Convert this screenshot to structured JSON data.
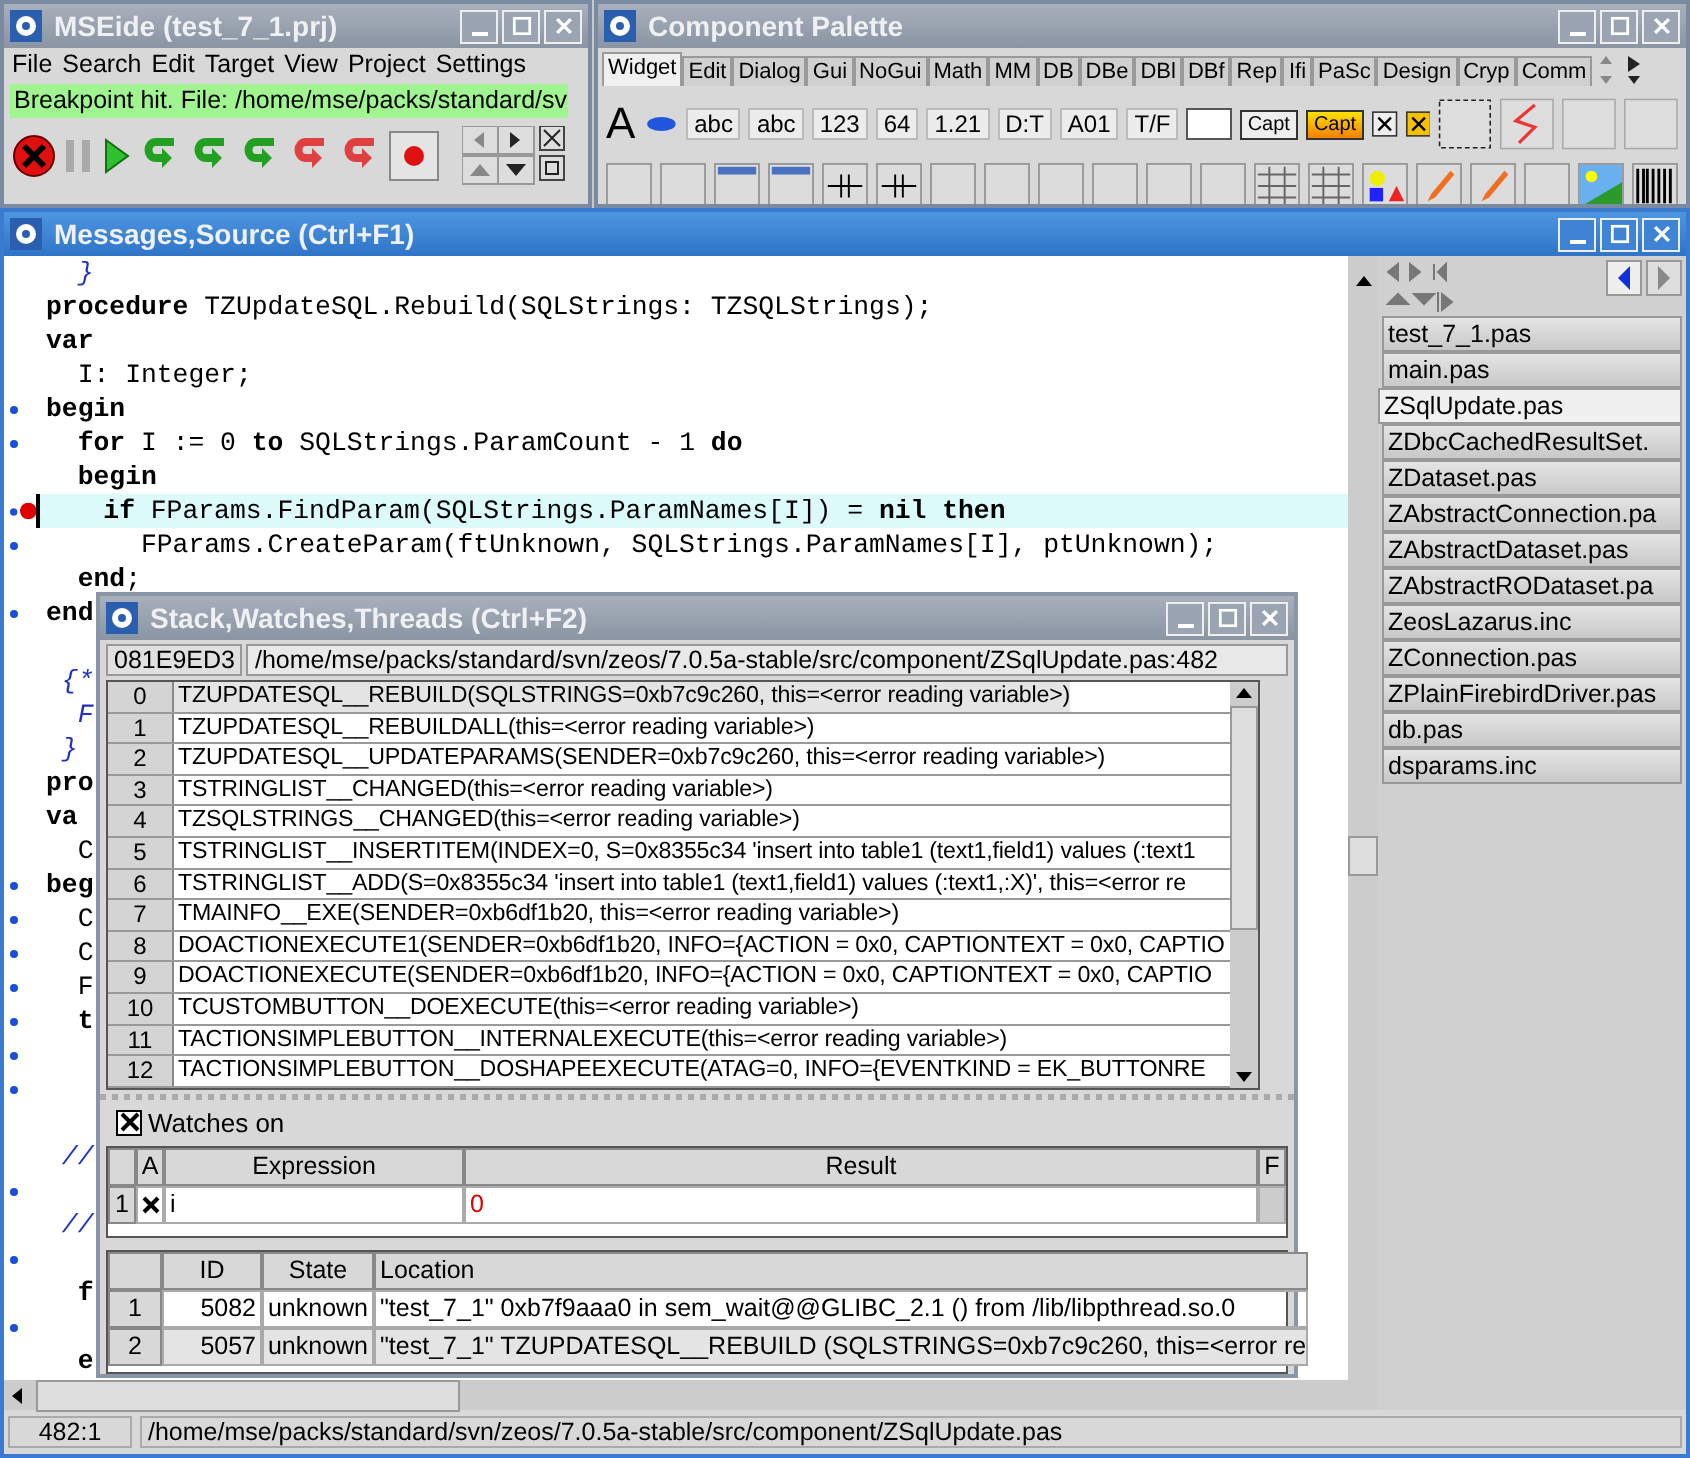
{
  "main_window": {
    "title": "MSEide (test_7_1.prj)",
    "active": false,
    "menu": [
      "File",
      "Search",
      "Edit",
      "Target",
      "View",
      "Project",
      "Settings"
    ],
    "status": "Breakpoint hit. File: /home/mse/packs/standard/sv"
  },
  "palette_window": {
    "title": "Component Palette",
    "active": false,
    "tabs": [
      {
        "label": "Widget",
        "selected": true
      },
      {
        "label": "Edit",
        "selected": false
      },
      {
        "label": "Dialog",
        "selected": false
      },
      {
        "label": "Gui",
        "selected": false
      },
      {
        "label": "NoGui",
        "selected": false
      },
      {
        "label": "Math",
        "selected": false
      },
      {
        "label": "MM",
        "selected": false
      },
      {
        "label": "DB",
        "selected": false
      },
      {
        "label": "DBe",
        "selected": false
      },
      {
        "label": "DBl",
        "selected": false
      },
      {
        "label": "DBf",
        "selected": false
      },
      {
        "label": "Rep",
        "selected": false
      },
      {
        "label": "Ifi",
        "selected": false
      },
      {
        "label": "PaSc",
        "selected": false
      },
      {
        "label": "Design",
        "selected": false
      },
      {
        "label": "Cryp",
        "selected": false
      },
      {
        "label": "Comm",
        "selected": false
      }
    ],
    "components": [
      {
        "label": "A",
        "kind": "large"
      },
      {
        "label": "abc",
        "kind": "field"
      },
      {
        "label": "abc",
        "kind": "field"
      },
      {
        "label": "123",
        "kind": "field"
      },
      {
        "label": "64",
        "kind": "field"
      },
      {
        "label": "1.21",
        "kind": "field"
      },
      {
        "label": "D:T",
        "kind": "field"
      },
      {
        "label": "A01",
        "kind": "field"
      },
      {
        "label": "T/F",
        "kind": "field"
      },
      {
        "label": "Capt",
        "kind": "button"
      },
      {
        "label": "Capt",
        "kind": "accent"
      }
    ]
  },
  "source_window": {
    "title": "Messages,Source (Ctrl+F1)",
    "active": true,
    "code_lines": [
      {
        "text": "  }",
        "kind": "comment",
        "exec_mark": false,
        "breakpoint": false,
        "current": false
      },
      {
        "text": "**procedure** TZUpdateSQL.Rebuild(SQLStrings: TZSQLStrings);",
        "kind": "code",
        "exec_mark": false,
        "breakpoint": false,
        "current": false
      },
      {
        "text": "**var**",
        "kind": "code",
        "exec_mark": false,
        "breakpoint": false,
        "current": false
      },
      {
        "text": "  I: Integer;",
        "kind": "code",
        "exec_mark": false,
        "breakpoint": false,
        "current": false
      },
      {
        "text": "**begin**",
        "kind": "code",
        "exec_mark": true,
        "breakpoint": false,
        "current": false
      },
      {
        "text": "  **for** I := 0 **to** SQLStrings.ParamCount - 1 **do**",
        "kind": "code",
        "exec_mark": true,
        "breakpoint": false,
        "current": false
      },
      {
        "text": "  **begin**",
        "kind": "code",
        "exec_mark": false,
        "breakpoint": false,
        "current": false
      },
      {
        "text": "    **if** FParams.FindParam(SQLStrings.ParamNames[I]) = **nil** **then**",
        "kind": "code",
        "exec_mark": true,
        "breakpoint": true,
        "current": true
      },
      {
        "text": "      FParams.CreateParam(ftUnknown, SQLStrings.ParamNames[I], ptUnknown);",
        "kind": "code",
        "exec_mark": true,
        "breakpoint": false,
        "current": false
      },
      {
        "text": "  **end**;",
        "kind": "code",
        "exec_mark": false,
        "breakpoint": false,
        "current": false
      },
      {
        "text": "**end**",
        "kind": "code",
        "exec_mark": true,
        "breakpoint": false,
        "current": false
      },
      {
        "exec_mark": false,
        "breakpoint": false,
        "current": false
      },
      {
        "text": " {*",
        "kind": "comment",
        "exec_mark": false,
        "breakpoint": false,
        "current": false
      },
      {
        "text": "  F",
        "kind": "comment",
        "exec_mark": false,
        "breakpoint": false,
        "current": false
      },
      {
        "text": " }",
        "kind": "comment",
        "exec_mark": false,
        "breakpoint": false,
        "current": false
      },
      {
        "text": "**pro**",
        "kind": "code",
        "exec_mark": false,
        "breakpoint": false,
        "current": false
      },
      {
        "text": "**va**",
        "kind": "code",
        "exec_mark": false,
        "breakpoint": false,
        "current": false
      },
      {
        "text": "  C",
        "kind": "code",
        "exec_mark": false,
        "breakpoint": false,
        "current": false
      },
      {
        "text": "**beg**",
        "kind": "code",
        "exec_mark": true,
        "breakpoint": false,
        "current": false
      },
      {
        "text": "  C",
        "kind": "code",
        "exec_mark": true,
        "breakpoint": false,
        "current": false
      },
      {
        "text": "  C",
        "kind": "code",
        "exec_mark": true,
        "breakpoint": false,
        "current": false
      },
      {
        "text": "  F",
        "kind": "code",
        "exec_mark": true,
        "breakpoint": false,
        "current": false
      },
      {
        "text": "  **t**",
        "kind": "code",
        "exec_mark": true,
        "breakpoint": false,
        "current": false
      },
      {
        "exec_mark": true,
        "breakpoint": false,
        "current": false
      },
      {
        "exec_mark": true,
        "breakpoint": false,
        "current": false
      },
      {
        "exec_mark": false,
        "breakpoint": false,
        "current": false
      },
      {
        "text": " //",
        "kind": "comment",
        "exec_mark": false,
        "breakpoint": false,
        "current": false
      },
      {
        "exec_mark": true,
        "breakpoint": false,
        "current": false
      },
      {
        "text": " //",
        "kind": "comment",
        "exec_mark": false,
        "breakpoint": false,
        "current": false
      },
      {
        "exec_mark": true,
        "breakpoint": false,
        "current": false
      },
      {
        "text": "  **f**",
        "kind": "code",
        "exec_mark": false,
        "breakpoint": false,
        "current": false
      },
      {
        "exec_mark": true,
        "breakpoint": false,
        "current": false
      },
      {
        "text": "  **e**",
        "kind": "code",
        "exec_mark": false,
        "breakpoint": false,
        "current": false
      }
    ],
    "file_tabs": [
      {
        "label": "test_7_1.pas",
        "selected": false
      },
      {
        "label": "main.pas",
        "selected": false
      },
      {
        "label": "ZSqlUpdate.pas",
        "selected": true
      },
      {
        "label": "ZDbcCachedResultSet.",
        "selected": false
      },
      {
        "label": "ZDataset.pas",
        "selected": false
      },
      {
        "label": "ZAbstractConnection.pa",
        "selected": false
      },
      {
        "label": "ZAbstractDataset.pas",
        "selected": false
      },
      {
        "label": "ZAbstractRODataset.pa",
        "selected": false
      },
      {
        "label": "ZeosLazarus.inc",
        "selected": false
      },
      {
        "label": "ZConnection.pas",
        "selected": false
      },
      {
        "label": "ZPlainFirebirdDriver.pas",
        "selected": false
      },
      {
        "label": "db.pas",
        "selected": false
      },
      {
        "label": "dsparams.inc",
        "selected": false
      }
    ],
    "status_bar": {
      "position": "482:1",
      "path": "/home/mse/packs/standard/svn/zeos/7.0.5a-stable/src/component/ZSqlUpdate.pas"
    }
  },
  "debug_window": {
    "title": "Stack,Watches,Threads (Ctrl+F2)",
    "active": false,
    "address": "081E9ED3",
    "location": "/home/mse/packs/standard/svn/zeos/7.0.5a-stable/src/component/ZSqlUpdate.pas:482",
    "stack": [
      {
        "index": "0",
        "frame": "TZUPDATESQL__REBUILD(SQLSTRINGS=0xb7c9c260, this=<error reading variable>)",
        "selected": true
      },
      {
        "index": "1",
        "frame": "TZUPDATESQL__REBUILDALL(this=<error reading variable>)",
        "selected": false
      },
      {
        "index": "2",
        "frame": "TZUPDATESQL__UPDATEPARAMS(SENDER=0xb7c9c260, this=<error reading variable>)",
        "selected": false
      },
      {
        "index": "3",
        "frame": "TSTRINGLIST__CHANGED(this=<error reading variable>)",
        "selected": false
      },
      {
        "index": "4",
        "frame": "TZSQLSTRINGS__CHANGED(this=<error reading variable>)",
        "selected": false
      },
      {
        "index": "5",
        "frame": "TSTRINGLIST__INSERTITEM(INDEX=0, S=0x8355c34 'insert into table1 (text1,field1) values (:text1",
        "selected": false
      },
      {
        "index": "6",
        "frame": "TSTRINGLIST__ADD(S=0x8355c34 'insert into table1 (text1,field1) values (:text1,:X)', this=<error re",
        "selected": false
      },
      {
        "index": "7",
        "frame": "TMAINFO__EXE(SENDER=0xb6df1b20, this=<error reading variable>)",
        "selected": false
      },
      {
        "index": "8",
        "frame": "DOACTIONEXECUTE1(SENDER=0xb6df1b20, INFO={ACTION = 0x0, CAPTIONTEXT = 0x0, CAPTIO",
        "selected": false
      },
      {
        "index": "9",
        "frame": "DOACTIONEXECUTE(SENDER=0xb6df1b20, INFO={ACTION = 0x0, CAPTIONTEXT = 0x0, CAPTIO",
        "selected": false
      },
      {
        "index": "10",
        "frame": "TCUSTOMBUTTON__DOEXECUTE(this=<error reading variable>)",
        "selected": false
      },
      {
        "index": "11",
        "frame": "TACTIONSIMPLEBUTTON__INTERNALEXECUTE(this=<error reading variable>)",
        "selected": false
      },
      {
        "index": "12",
        "frame": "TACTIONSIMPLEBUTTON__DOSHAPEEXECUTE(ATAG=0, INFO={EVENTKIND = EK_BUTTONRE",
        "selected": false
      }
    ],
    "watches_on": {
      "label": "Watches on",
      "checked": true
    },
    "watch_columns": [
      "A",
      "Expression",
      "Result",
      "F"
    ],
    "watches": [
      {
        "index": "1",
        "active": true,
        "expression": "i",
        "result": "0"
      }
    ],
    "thread_columns": [
      "ID",
      "State",
      "Location"
    ],
    "threads": [
      {
        "index": "1",
        "id": "5082",
        "state": "unknown",
        "location": "\"test_7_1\" 0xb7f9aaa0 in sem_wait@@GLIBC_2.1 () from /lib/libpthread.so.0",
        "selected": false
      },
      {
        "index": "2",
        "id": "5057",
        "state": "unknown",
        "location": "\"test_7_1\" TZUPDATESQL__REBUILD (SQLSTRINGS=0xb7c9c260, this=<error re",
        "selected": true
      }
    ]
  }
}
